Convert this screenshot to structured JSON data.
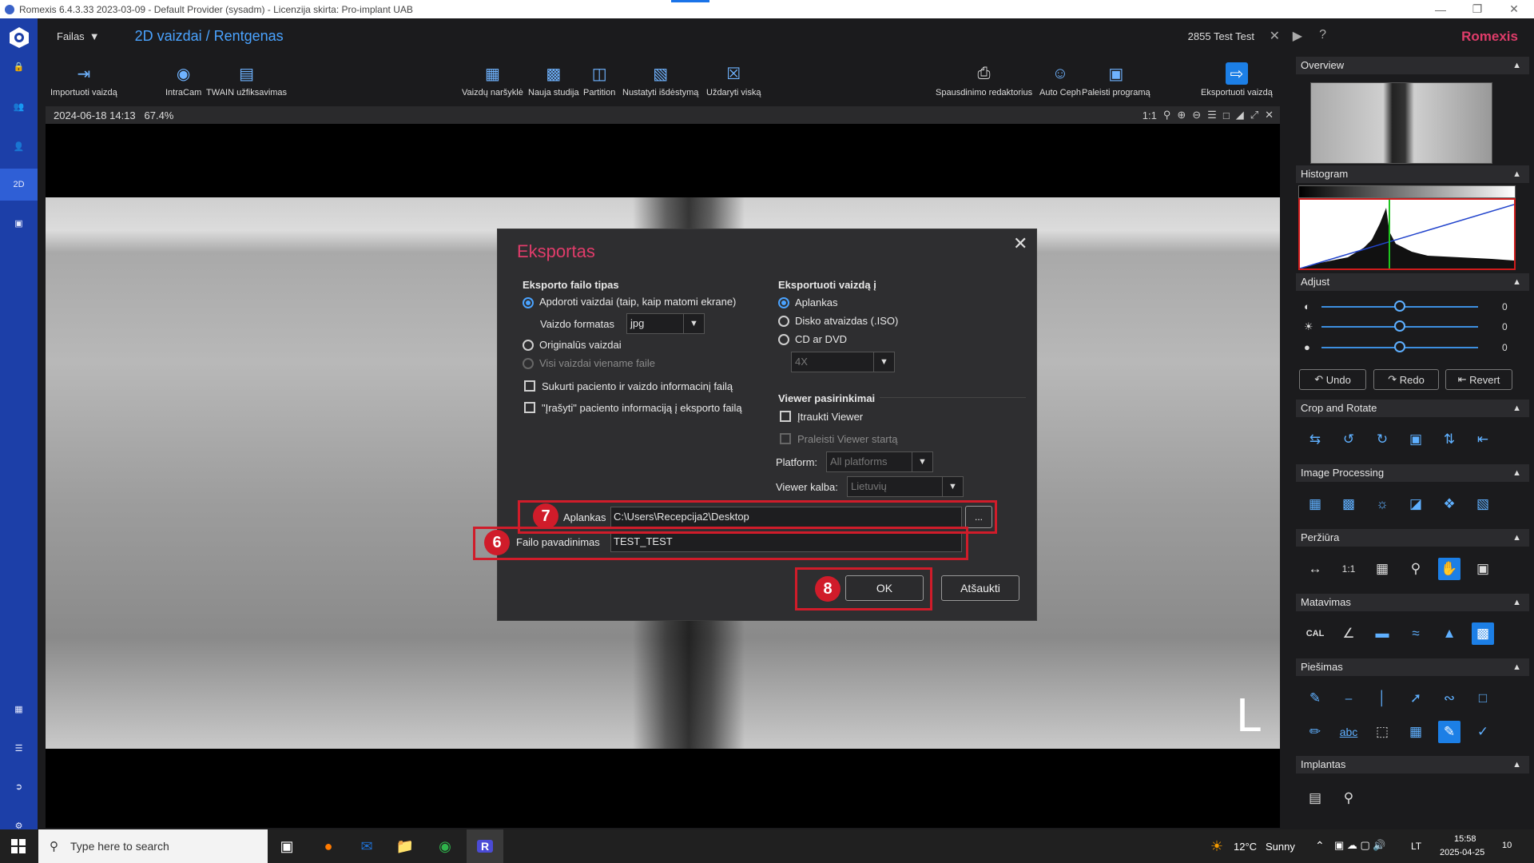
{
  "window": {
    "title": "Romexis 6.4.3.33 2023-03-09 - Default Provider (sysadm) - Licenzija skirta: Pro-implant UAB"
  },
  "header": {
    "file_menu": "Failas",
    "page_title": "2D vaizdai / Rentgenas",
    "patient": "2855 Test Test",
    "brand": "Romexis"
  },
  "toolbar": {
    "import": "Importuoti vaizdą",
    "intracam": "IntraCam",
    "twain": "TWAIN užfiksavimas",
    "browser": "Vaizdų naršyklė",
    "new_study": "Nauja studija",
    "partition": "Partition",
    "set_layout": "Nustatyti išdėstymą",
    "close_all": "Uždaryti viską",
    "print_editor": "Spausdinimo redaktorius",
    "auto_ceph": "Auto Ceph",
    "launch_program": "Paleisti programą",
    "export": "Eksportuoti vaizdą"
  },
  "viewer": {
    "timestamp": "2024-06-18 14:13",
    "zoom": "67.4%",
    "one_to_one": "1:1",
    "orientation_mark": "L"
  },
  "right_panel": {
    "overview": "Overview",
    "histogram": "Histogram",
    "adjust": "Adjust",
    "adjust_values": [
      "0",
      "0",
      "0"
    ],
    "undo": "Undo",
    "redo": "Redo",
    "revert": "Revert",
    "crop_rotate": "Crop and Rotate",
    "image_processing": "Image Processing",
    "view": "Peržiūra",
    "view_1to1": "1:1",
    "measure": "Matavimas",
    "measure_cal": "CAL",
    "drawing": "Piešimas",
    "drawing_abc": "abc",
    "implants": "Implantas"
  },
  "dialog": {
    "title": "Eksportas",
    "file_type_header": "Eksporto failo tipas",
    "processed_images": "Apdoroti vaizdai (taip, kaip matomi ekrane)",
    "image_format_label": "Vaizdo formatas",
    "image_format_value": "jpg",
    "original_images": "Originalūs vaizdai",
    "all_in_one": "Visi vaizdai viename faile",
    "create_info_file": "Sukurti paciento ir vaizdo informacinį failą",
    "write_patient_info": "\"Įrašyti\" paciento informaciją į eksporto failą",
    "export_to_header": "Eksportuoti vaizdą į",
    "folder": "Aplankas",
    "disk_image": "Disko atvaizdas (.ISO)",
    "cd_dvd": "CD ar DVD",
    "speed": "4X",
    "viewer_options_header": "Viewer pasirinkimai",
    "include_viewer": "Įtraukti Viewer",
    "skip_viewer_start": "Praleisti Viewer startą",
    "platform_label": "Platform:",
    "platform_value": "All platforms",
    "viewer_language_label": "Viewer kalba:",
    "viewer_language_value": "Lietuvių",
    "folder_label": "Aplankas",
    "folder_value": "C:\\Users\\Recepcija2\\Desktop",
    "browse": "...",
    "filename_label": "Failo pavadinimas",
    "filename_value": "TEST_TEST",
    "ok": "OK",
    "cancel": "Atšaukti",
    "callouts": [
      "7",
      "6",
      "8"
    ]
  },
  "taskbar": {
    "search_placeholder": "Type here to search",
    "weather_temp": "12°C",
    "weather_desc": "Sunny",
    "lang": "LT",
    "time": "15:58",
    "date": "2025-04-25",
    "notif_count": "10"
  },
  "colors": {
    "accent": "#4aa3ff",
    "brand": "#e03c6a",
    "nav": "#1c3fa8",
    "highlight": "#d01c2a"
  }
}
